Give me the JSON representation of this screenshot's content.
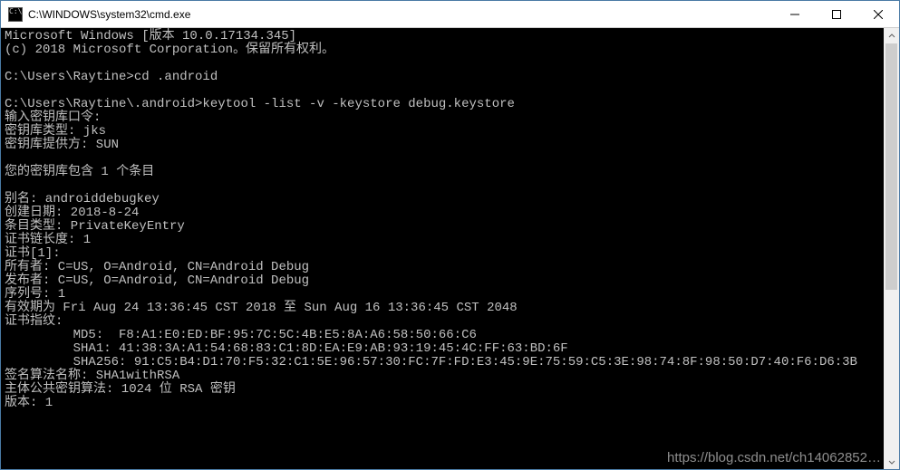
{
  "window": {
    "title": "C:\\WINDOWS\\system32\\cmd.exe",
    "icon_label": "C:\\."
  },
  "terminal": {
    "lines": [
      "Microsoft Windows [版本 10.0.17134.345]",
      "(c) 2018 Microsoft Corporation。保留所有权利。",
      "",
      "C:\\Users\\Raytine>cd .android",
      "",
      "C:\\Users\\Raytine\\.android>keytool -list -v -keystore debug.keystore",
      "输入密钥库口令:",
      "密钥库类型: jks",
      "密钥库提供方: SUN",
      "",
      "您的密钥库包含 1 个条目",
      "",
      "别名: androiddebugkey",
      "创建日期: 2018-8-24",
      "条目类型: PrivateKeyEntry",
      "证书链长度: 1",
      "证书[1]:",
      "所有者: C=US, O=Android, CN=Android Debug",
      "发布者: C=US, O=Android, CN=Android Debug",
      "序列号: 1",
      "有效期为 Fri Aug 24 13:36:45 CST 2018 至 Sun Aug 16 13:36:45 CST 2048",
      "证书指纹:",
      "         MD5:  F8:A1:E0:ED:BF:95:7C:5C:4B:E5:8A:A6:58:50:66:C6",
      "         SHA1: 41:38:3A:A1:54:68:83:C1:8D:EA:E9:AB:93:19:45:4C:FF:63:BD:6F",
      "         SHA256: 91:C5:B4:D1:70:F5:32:C1:5E:96:57:30:FC:7F:FD:E3:45:9E:75:59:C5:3E:98:74:8F:98:50:D7:40:F6:D6:3B",
      "签名算法名称: SHA1withRSA",
      "主体公共密钥算法: 1024 位 RSA 密钥",
      "版本: 1",
      ""
    ]
  },
  "watermark": "https://blog.csdn.net/ch14062852…"
}
